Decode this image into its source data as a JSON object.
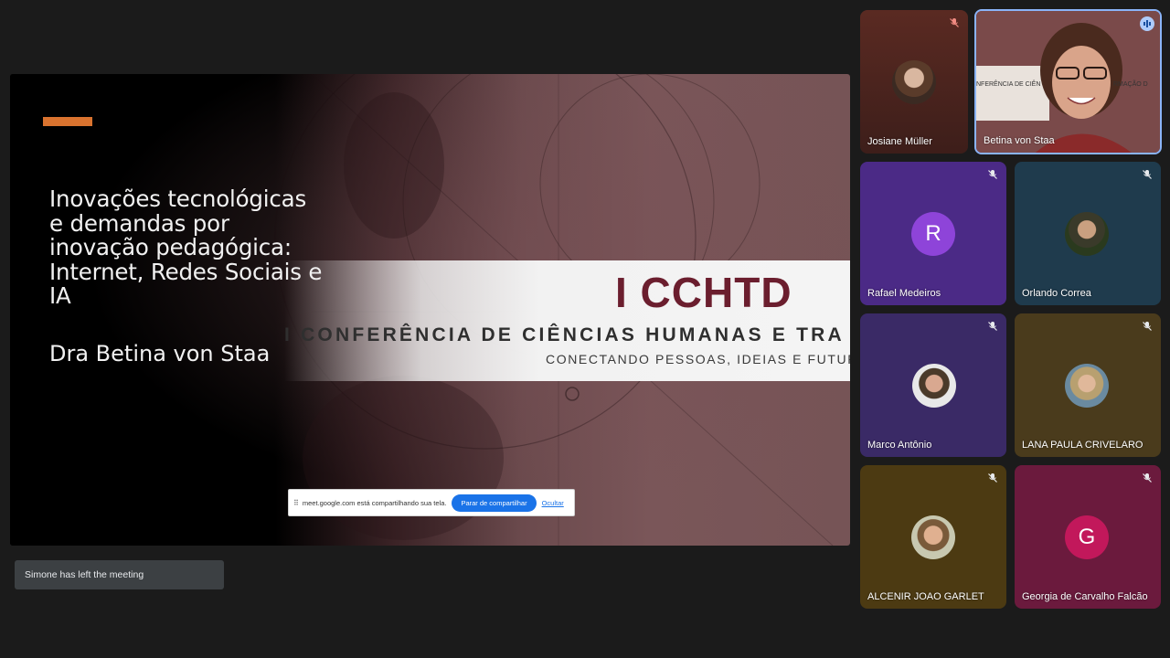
{
  "presentation": {
    "slide_title": "Inovações tecnológicas e demandas por inovação pedagógica: Internet, Redes Sociais e IA",
    "slide_author": "Dra Betina von Staa",
    "banner_logo": "I CCHTD",
    "banner_line1": "I CONFERÊNCIA DE CIÊNCIAS HUMANAS E TRA",
    "banner_line2": "CONECTANDO PESSOAS, IDEIAS E FUTUROS",
    "accent_color": "#d9732f",
    "logo_color": "#6b1e2e"
  },
  "share_bar": {
    "message": "meet.google.com está compartilhando sua tela.",
    "stop_label": "Parar de compartilhar",
    "hide_label": "Ocultar"
  },
  "toast": {
    "message": "Simone has left the meeting"
  },
  "participants": [
    {
      "name": "Josiane Müller",
      "muted": true,
      "avatar": "photo"
    },
    {
      "name": "Betina von Staa",
      "muted": false,
      "speaking": true,
      "avatar": "video"
    },
    {
      "name": "Rafael Medeiros",
      "muted": true,
      "avatar": "letter",
      "letter": "R",
      "tile_color": "#4b2a86",
      "avatar_color": "#8e44d9"
    },
    {
      "name": "Orlando Correa",
      "muted": true,
      "avatar": "photo",
      "tile_color": "#1f3b4d"
    },
    {
      "name": "Marco Antônio",
      "muted": true,
      "avatar": "photo",
      "tile_color": "#3a2a66"
    },
    {
      "name": "LANA PAULA CRIVELARO",
      "muted": true,
      "avatar": "photo",
      "tile_color": "#4a3b1c"
    },
    {
      "name": "ALCENIR JOAO GARLET",
      "muted": true,
      "avatar": "photo",
      "tile_color": "#4c3a12"
    },
    {
      "name": "Georgia de Carvalho Falcão",
      "muted": true,
      "avatar": "letter",
      "letter": "G",
      "tile_color": "#6b1a3d",
      "avatar_color": "#c2185b"
    }
  ]
}
